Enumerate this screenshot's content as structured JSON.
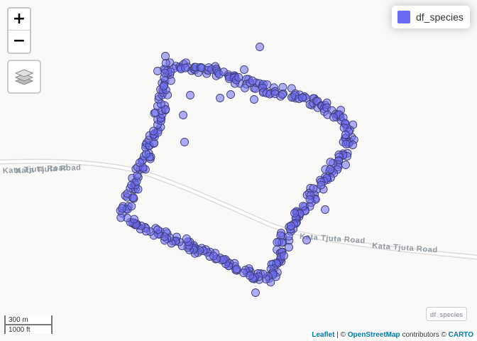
{
  "map": {
    "roads": [
      {
        "label": "Kata Tjuta Road"
      },
      {
        "label": "Kata Tjuta Road"
      },
      {
        "label": "Kata Tjuta Road"
      },
      {
        "label": "Kata Tjuta Road"
      }
    ],
    "road_label_west_partial": "Kata Tjuta Road"
  },
  "controls": {
    "zoom_in_label": "+",
    "zoom_out_label": "−",
    "layers_icon": "layers-icon"
  },
  "legend": {
    "label": "df_species",
    "color": "#6b6bf5"
  },
  "group_tag": "df_species",
  "scale": {
    "metric": "300 m",
    "imperial": "1000 ft"
  },
  "attribution": {
    "leaflet": "Leaflet",
    "sep1": " | © ",
    "osm": "OpenStreetMap",
    "mid": " contributors © ",
    "carto": "CARTO"
  },
  "points": {
    "fill": "#6b6bf5",
    "stroke": "#3d3d70"
  }
}
